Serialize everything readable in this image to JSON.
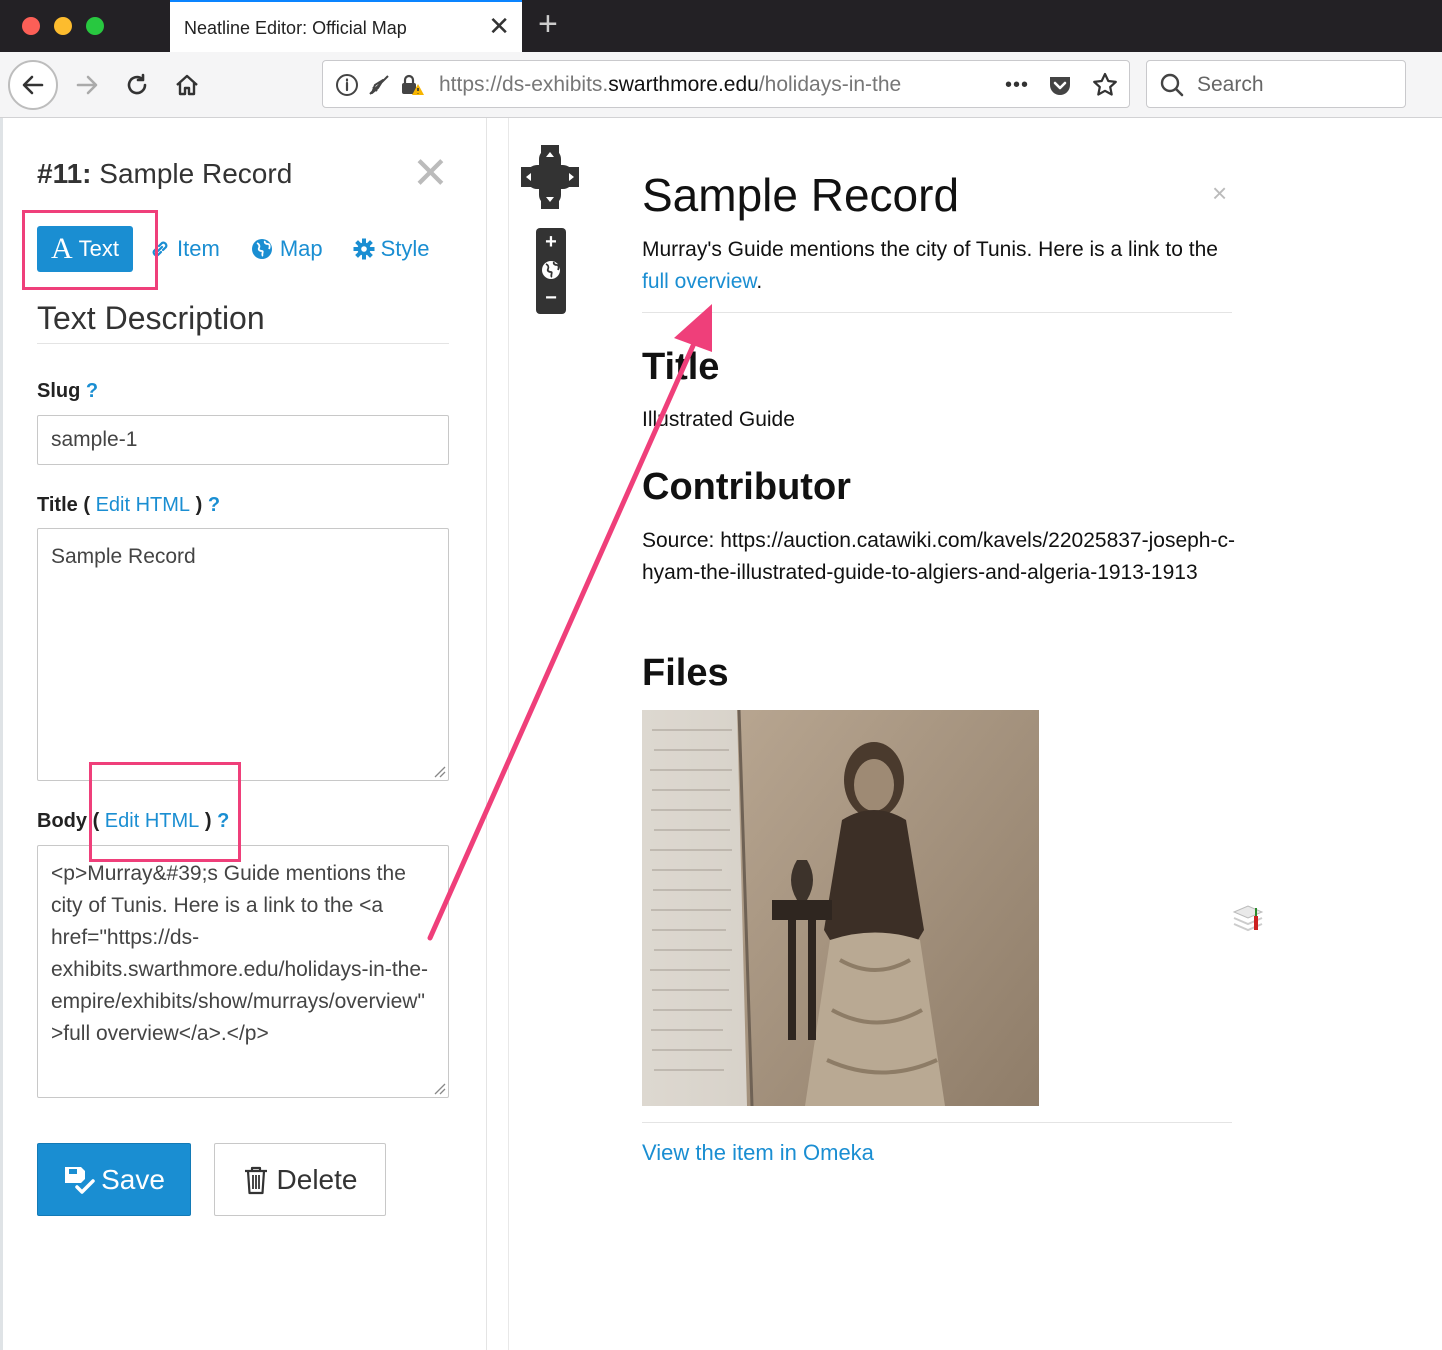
{
  "browser": {
    "tab_title": "Neatline Editor: Official Map",
    "url_prefix": "https://ds-exhibits.",
    "url_host": "swarthmore.edu",
    "url_path": "/holidays-in-the",
    "search_placeholder": "Search",
    "more_dots": "•••"
  },
  "editor": {
    "record_number": "#11:",
    "record_name": "Sample Record",
    "tabs": [
      {
        "label": "Text",
        "icon_glyph": "A"
      },
      {
        "label": "Item"
      },
      {
        "label": "Map"
      },
      {
        "label": "Style"
      }
    ],
    "section_title": "Text Description",
    "slug_label": "Slug",
    "slug_value": "sample-1",
    "title_label": "Title",
    "title_value": "Sample Record",
    "body_label": "Body",
    "edit_html_label": "Edit HTML",
    "paren_open": "(",
    "paren_close": ")",
    "help_mark": "?",
    "body_value": "<p>Murray&#39;s Guide mentions the city of Tunis. Here is a link to the <a href=\"https://ds-exhibits.swarthmore.edu/holidays-in-the-empire/exhibits/show/murrays/overview\">full overview</a>.</p>",
    "save_label": "Save",
    "delete_label": "Delete"
  },
  "popup": {
    "title": "Sample Record",
    "close": "×",
    "body_text": "Murray's Guide mentions the city of Tunis. Here is a link to the ",
    "body_link": "full overview",
    "body_end": ".",
    "title_heading": "Title",
    "title_value": "Illustrated Guide",
    "contributor_heading": "Contributor",
    "contributor_value": "Source: https://auction.catawiki.com/kavels/22025837-joseph-c-hyam-the-illustrated-guide-to-algiers-and-algeria-1913-1913",
    "files_heading": "Files",
    "omeka_link": "View the item in Omeka"
  },
  "zoom": {
    "plus": "+",
    "minus": "−"
  },
  "colors": {
    "accent": "#1a8ed2",
    "highlight": "#ef3f7a"
  }
}
